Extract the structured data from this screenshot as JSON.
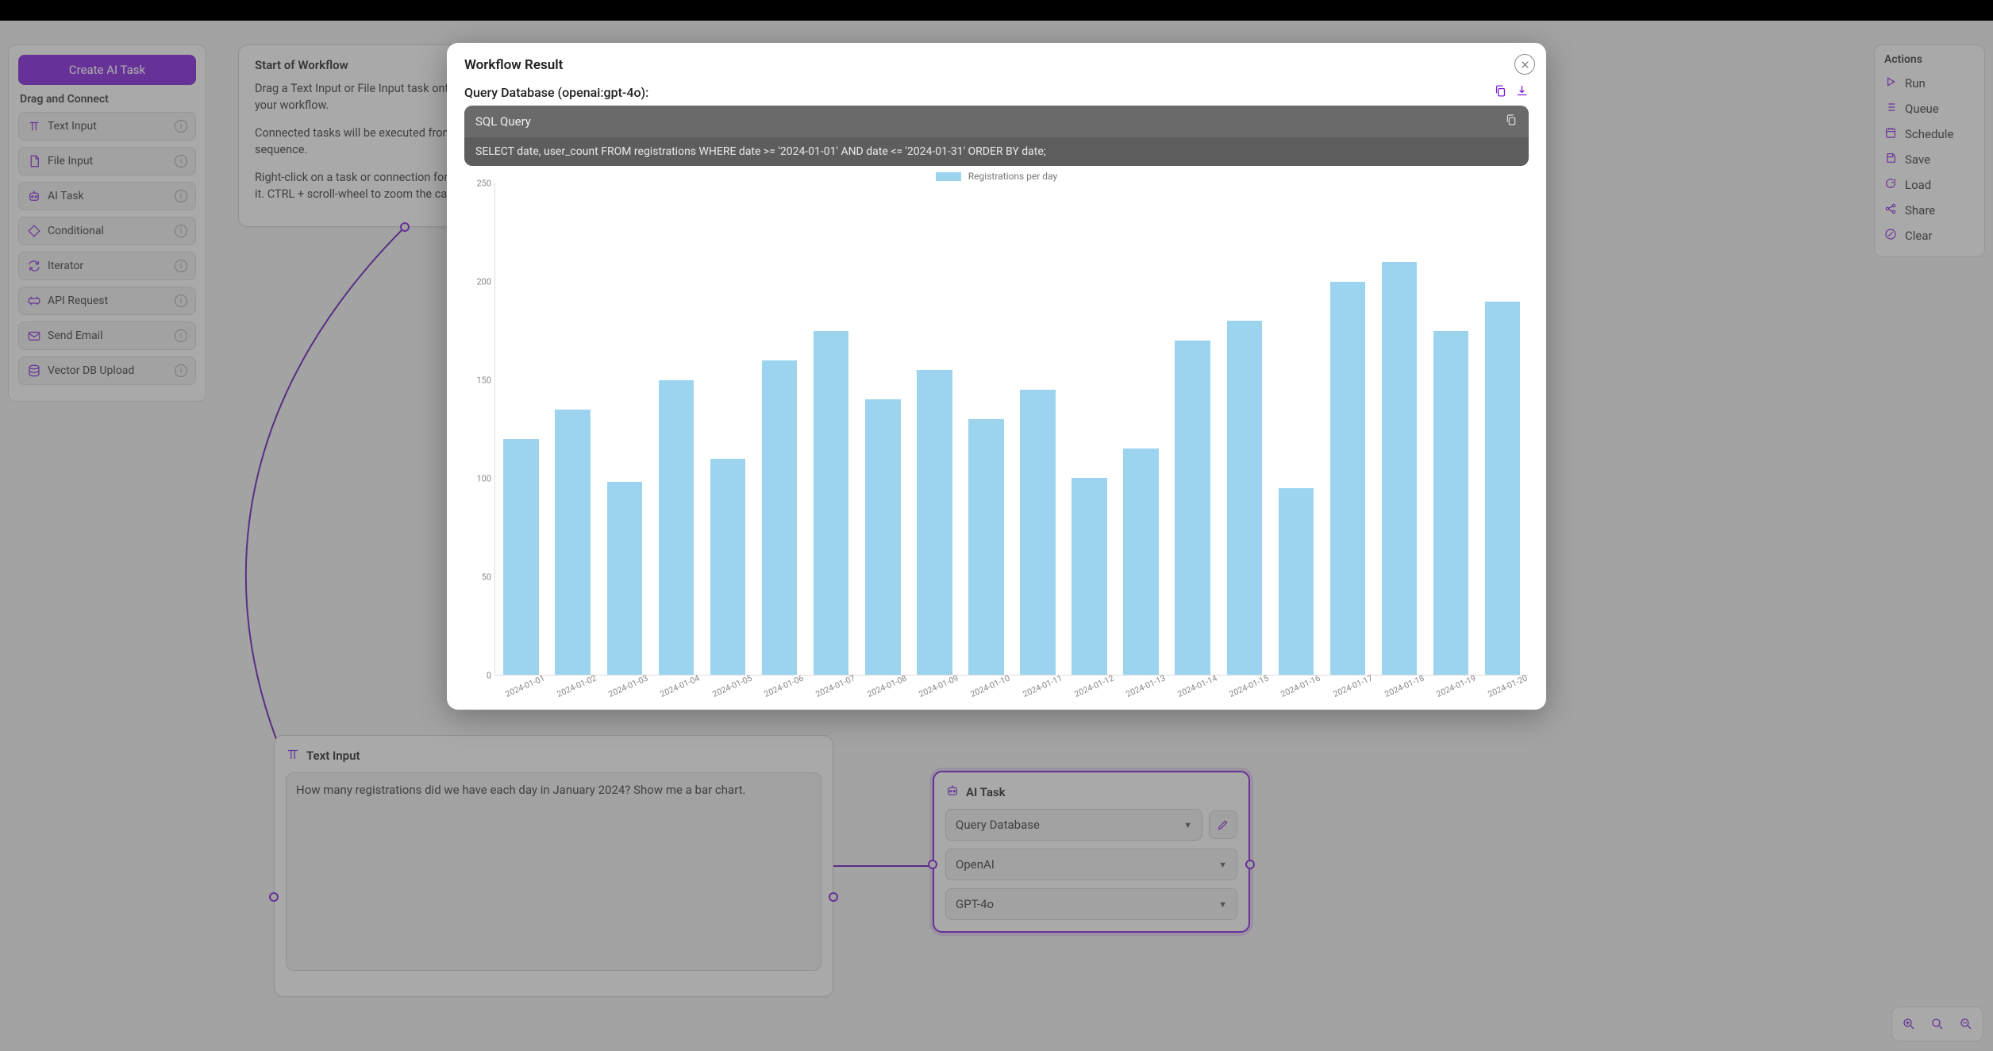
{
  "sidebar": {
    "create_label": "Create AI Task",
    "drag_label": "Drag and Connect",
    "tools": [
      {
        "label": "Text Input",
        "icon": "type-icon"
      },
      {
        "label": "File Input",
        "icon": "file-icon"
      },
      {
        "label": "AI Task",
        "icon": "robot-icon"
      },
      {
        "label": "Conditional",
        "icon": "diamond-icon"
      },
      {
        "label": "Iterator",
        "icon": "loop-icon"
      },
      {
        "label": "API Request",
        "icon": "api-icon"
      },
      {
        "label": "Send Email",
        "icon": "mail-icon"
      },
      {
        "label": "Vector DB Upload",
        "icon": "db-icon"
      }
    ]
  },
  "actions": {
    "heading": "Actions",
    "items": [
      {
        "label": "Run",
        "icon": "play-icon"
      },
      {
        "label": "Queue",
        "icon": "list-icon"
      },
      {
        "label": "Schedule",
        "icon": "calendar-icon"
      },
      {
        "label": "Save",
        "icon": "save-icon"
      },
      {
        "label": "Load",
        "icon": "load-icon"
      },
      {
        "label": "Share",
        "icon": "share-icon"
      },
      {
        "label": "Clear",
        "icon": "clear-icon"
      }
    ]
  },
  "start_node": {
    "title": "Start of Workflow",
    "p1": "Drag a Text Input or File Input task onto the canvas to start your workflow.",
    "p2": "Connected tasks will be executed from top-to-bottom in sequence.",
    "p3": "Right-click on a task or connection for the option to delete it. CTRL + scroll-wheel to zoom the canvas in and out."
  },
  "textinput_node": {
    "title": "Text Input",
    "value": "How many registrations did we have each day in January 2024? Show me a bar chart."
  },
  "aitask_node": {
    "title": "AI Task",
    "task_select": "Query Database",
    "provider_select": "OpenAI",
    "model_select": "GPT-4o"
  },
  "modal": {
    "title": "Workflow Result",
    "result_title": "Query Database (openai:gpt-4o):",
    "sql_heading": "SQL Query",
    "sql_body": "SELECT date, user_count FROM registrations WHERE date >= '2024-01-01' AND date <= '2024-01-31' ORDER BY date;"
  },
  "chart_data": {
    "type": "bar",
    "title": "",
    "legend_label": "Registrations per day",
    "xlabel": "",
    "ylabel": "",
    "ylim": [
      0,
      250
    ],
    "yticks": [
      0,
      50,
      100,
      150,
      200,
      250
    ],
    "categories": [
      "2024-01-01",
      "2024-01-02",
      "2024-01-03",
      "2024-01-04",
      "2024-01-05",
      "2024-01-06",
      "2024-01-07",
      "2024-01-08",
      "2024-01-09",
      "2024-01-10",
      "2024-01-11",
      "2024-01-12",
      "2024-01-13",
      "2024-01-14",
      "2024-01-15",
      "2024-01-16",
      "2024-01-17",
      "2024-01-18",
      "2024-01-19",
      "2024-01-20"
    ],
    "values": [
      120,
      135,
      98,
      150,
      110,
      160,
      175,
      140,
      155,
      130,
      145,
      100,
      115,
      170,
      180,
      95,
      200,
      210,
      175,
      190
    ]
  }
}
